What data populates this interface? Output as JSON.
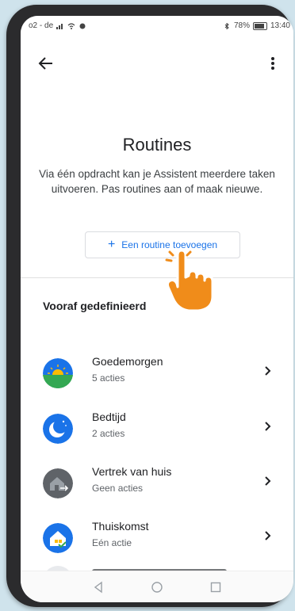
{
  "status": {
    "carrier": "o2 - de",
    "battery": "78%",
    "time": "13:40",
    "battery_level": 0.78
  },
  "header": {
    "back_icon": "arrow-left-icon",
    "menu_icon": "more-vertical-icon"
  },
  "hero": {
    "title": "Routines",
    "description": "Via één opdracht kan je Assistent meerdere taken uitvoeren. Pas routines aan of maak nieuwe.",
    "add_button_label": "Een routine toevoegen"
  },
  "predefined": {
    "title": "Vooraf gedefinieerd",
    "items": [
      {
        "name": "Goedemorgen",
        "subtitle": "5 acties",
        "icon": "sunrise-icon"
      },
      {
        "name": "Bedtijd",
        "subtitle": "2 acties",
        "icon": "moon-icon"
      },
      {
        "name": "Vertrek van huis",
        "subtitle": "Geen acties",
        "icon": "house-leave-icon"
      },
      {
        "name": "Thuiskomst",
        "subtitle": "Eén actie",
        "icon": "house-arrive-icon"
      }
    ]
  },
  "colors": {
    "accent": "#1a73e8",
    "sunrise_sky": "#1a73e8",
    "sunrise_ground": "#34a853",
    "sun": "#fbbc04",
    "bedtime": "#1a73e8",
    "leave_house": "#5f6368",
    "arrive_house": "#1a73e8",
    "pointer_hand": "#f08c1a"
  }
}
